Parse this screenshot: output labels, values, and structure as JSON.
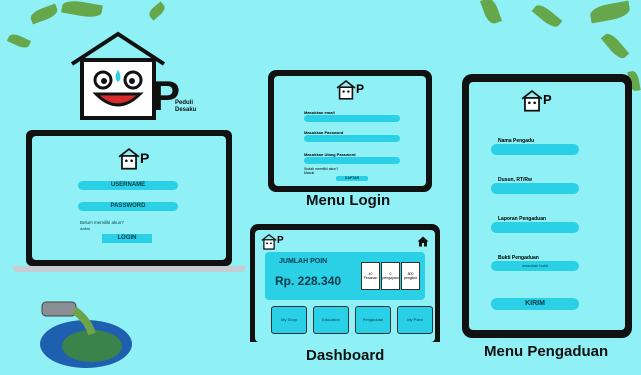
{
  "brand": {
    "line1": "Peduli",
    "line2": "Desaku",
    "letter": "P"
  },
  "laptop": {
    "username": "USERNAME",
    "password": "PASSWORD",
    "no_account": "Belum memiliki akun?",
    "register": "daftar",
    "login": "LOGIN"
  },
  "tablet_login": {
    "email": "Masukkan email",
    "password": "Masukkan Password",
    "password_confirm": "Masukkan Ulang Password",
    "have_account": "Sudah memiliki akun?",
    "signin": "Masuk",
    "submit": "DAFTAR"
  },
  "dashboard": {
    "points_label": "JUMLAH POIN",
    "points_value": "Rp. 228.340",
    "stats": [
      "40 Pesanan",
      "0 pengajuan",
      "800 pengikut"
    ],
    "nav": [
      "My Shop",
      "Education",
      "Pengaduan",
      "My Point"
    ]
  },
  "complaint": {
    "name": "Nama Pengadu",
    "address": "Dusun, RT/Rw",
    "report": "Laporan Pengaduan",
    "proof": "Bukti Pengaduan",
    "upload": "masukan bukti",
    "submit": "KIRIM"
  },
  "captions": {
    "login": "Menu Login",
    "dashboard": "Dashboard",
    "complaint": "Menu Pengaduan"
  },
  "colors": {
    "bg": "#8ff0f6",
    "accent": "#29d0e6",
    "frame": "#111111"
  }
}
